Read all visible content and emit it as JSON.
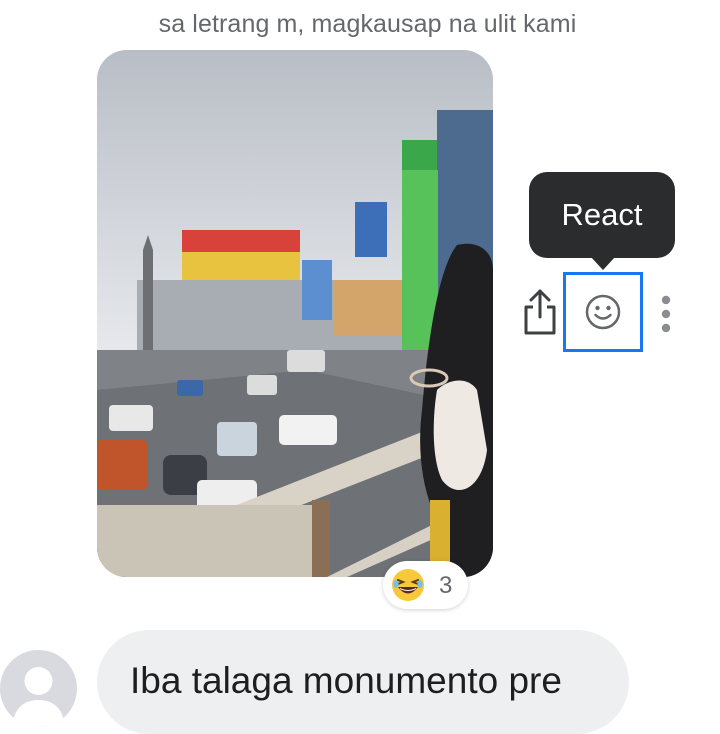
{
  "message_caption": "sa letrang m, magkausap na ulit kami",
  "photo": {
    "icon": "photo-image"
  },
  "reaction": {
    "emoji": "laughing-face-emoji",
    "count": "3"
  },
  "tooltip": {
    "label": "React"
  },
  "actions": {
    "share_icon": "share-icon",
    "react_icon": "smiley-face-icon",
    "more_icon": "vertical-dots-icon"
  },
  "reply": {
    "avatar_icon": "default-user-avatar-icon",
    "text": "Iba talaga monumento pre"
  },
  "colors": {
    "focus_outline": "#1877f2",
    "tooltip_bg": "#2b2c2e",
    "bubble_bg": "#eeeff1",
    "caption_text": "#65676b"
  }
}
